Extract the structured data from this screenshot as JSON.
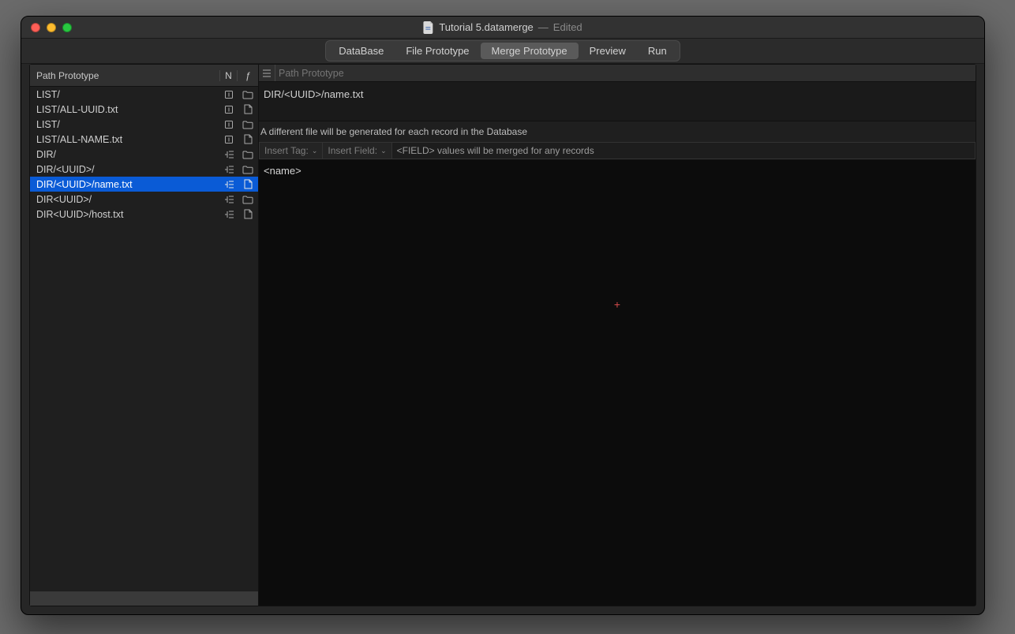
{
  "window": {
    "title": "Tutorial 5.datamerge",
    "edited_label": "Edited"
  },
  "tabs": {
    "items": [
      "DataBase",
      "File Prototype",
      "Merge Prototype",
      "Preview",
      "Run"
    ],
    "active_index": 2
  },
  "sidebar": {
    "header": {
      "path": "Path Prototype",
      "n": "N",
      "f": "ƒ"
    },
    "rows": [
      {
        "label": "LIST/",
        "n_kind": "one",
        "f_kind": "folder",
        "selected": false
      },
      {
        "label": "LIST/ALL-UUID.txt",
        "n_kind": "one",
        "f_kind": "file",
        "selected": false
      },
      {
        "label": "LIST/",
        "n_kind": "one",
        "f_kind": "folder",
        "selected": false
      },
      {
        "label": "LIST/ALL-NAME.txt",
        "n_kind": "one",
        "f_kind": "file",
        "selected": false
      },
      {
        "label": "DIR/",
        "n_kind": "many",
        "f_kind": "folder",
        "selected": false
      },
      {
        "label": "DIR/<UUID>/",
        "n_kind": "many",
        "f_kind": "folder",
        "selected": false
      },
      {
        "label": "DIR/<UUID>/name.txt",
        "n_kind": "many",
        "f_kind": "file",
        "selected": true
      },
      {
        "label": "DIR<UUID>/",
        "n_kind": "many",
        "f_kind": "folder",
        "selected": false
      },
      {
        "label": "DIR<UUID>/host.txt",
        "n_kind": "many",
        "f_kind": "file",
        "selected": false
      }
    ]
  },
  "detail": {
    "path_label": "Path Prototype",
    "path_value": "DIR/<UUID>/name.txt",
    "record_hint": "A different file will be generated for each record in the Database",
    "insert_tag_label": "Insert Tag:",
    "insert_field_label": "Insert Field:",
    "merge_hint": "<FIELD> values will be merged for any records",
    "editor_content": "<name>"
  }
}
